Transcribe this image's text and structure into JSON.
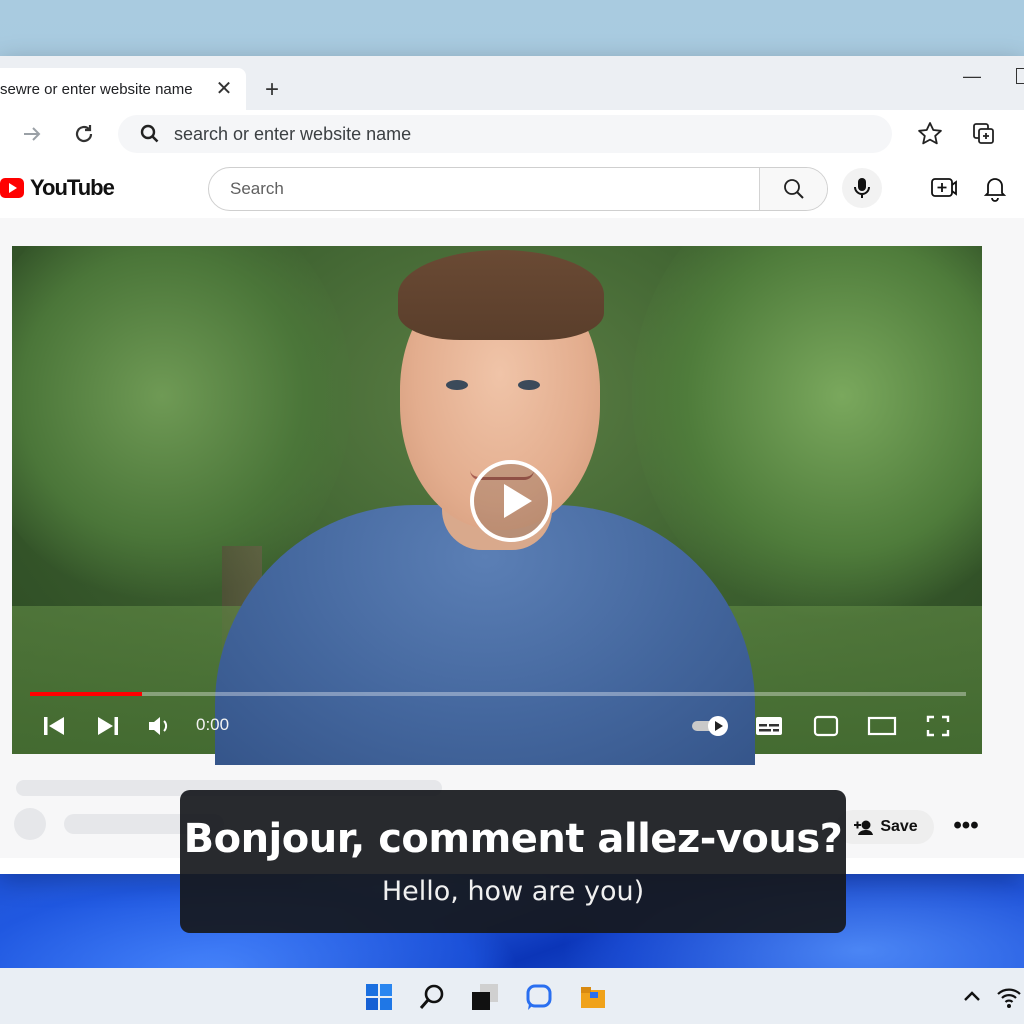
{
  "browser": {
    "tab_title": "sewre or enter website name",
    "tab_close": "✕",
    "new_tab": "+",
    "minimize": "—",
    "address": "search or enter website name"
  },
  "youtube": {
    "logo_text": "YouTube",
    "search_placeholder": "Search",
    "save_label": "Save",
    "more_label": "•••"
  },
  "player": {
    "time": "0:00",
    "progress_fraction": 0.12
  },
  "subtitles": {
    "main": "Bonjour, comment allez-vous?",
    "translation": "Hello, how are you)"
  },
  "colors": {
    "brand_red": "#ff0000",
    "taskbar_blue": "#1a5fd6"
  },
  "icons": {
    "taskbar": [
      "windows-start-icon",
      "search-icon",
      "task-view-icon",
      "chat-icon",
      "file-explorer-icon"
    ],
    "tray": [
      "chevron-up-icon",
      "wifi-icon"
    ]
  }
}
